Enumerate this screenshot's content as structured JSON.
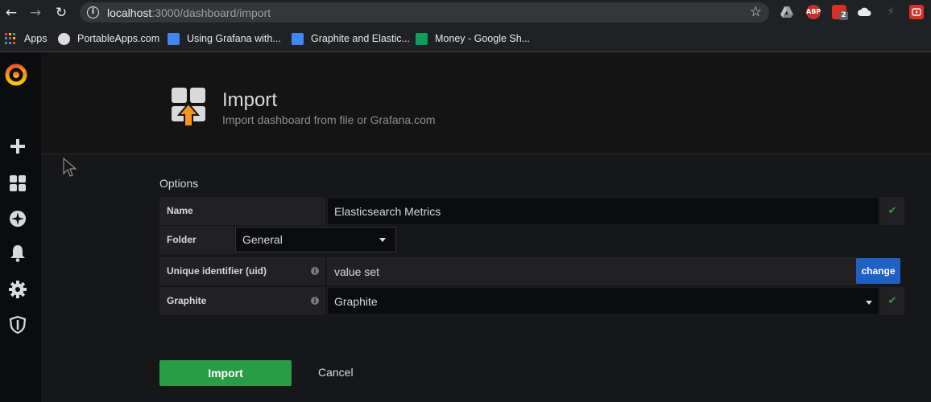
{
  "browser": {
    "url_host": "localhost",
    "url_rest": ":3000/dashboard/import",
    "bookmarks": [
      {
        "label": "Apps"
      },
      {
        "label": "PortableApps.com"
      },
      {
        "label": "Using Grafana with..."
      },
      {
        "label": "Graphite and Elastic..."
      },
      {
        "label": "Money - Google Sh..."
      }
    ],
    "extensions": [
      {
        "name": "google-drive-icon",
        "text": ""
      },
      {
        "name": "adblock-plus-icon",
        "text": "ABP"
      },
      {
        "name": "extension-badge-icon",
        "text": "2"
      },
      {
        "name": "cloud-icon",
        "text": ""
      },
      {
        "name": "lightning-icon",
        "text": ""
      },
      {
        "name": "youtube-icon",
        "text": ""
      }
    ]
  },
  "sidebar": {
    "items": [
      "grafana-logo",
      "create",
      "dashboards",
      "explore",
      "alerting",
      "configuration",
      "server-admin"
    ]
  },
  "header": {
    "title": "Import",
    "subtitle": "Import dashboard from file or Grafana.com"
  },
  "options": {
    "title": "Options",
    "name_label": "Name",
    "name_value": "Elasticsearch Metrics",
    "folder_label": "Folder",
    "folder_value": "General",
    "uid_label": "Unique identifier (uid)",
    "uid_value": "value set",
    "change_label": "change",
    "datasource_label": "Graphite",
    "datasource_value": "Graphite"
  },
  "actions": {
    "import_label": "Import",
    "cancel_label": "Cancel"
  },
  "colors": {
    "accent_green": "#299c46",
    "accent_blue": "#1f60c4",
    "background": "#161719",
    "panel": "#212124"
  }
}
